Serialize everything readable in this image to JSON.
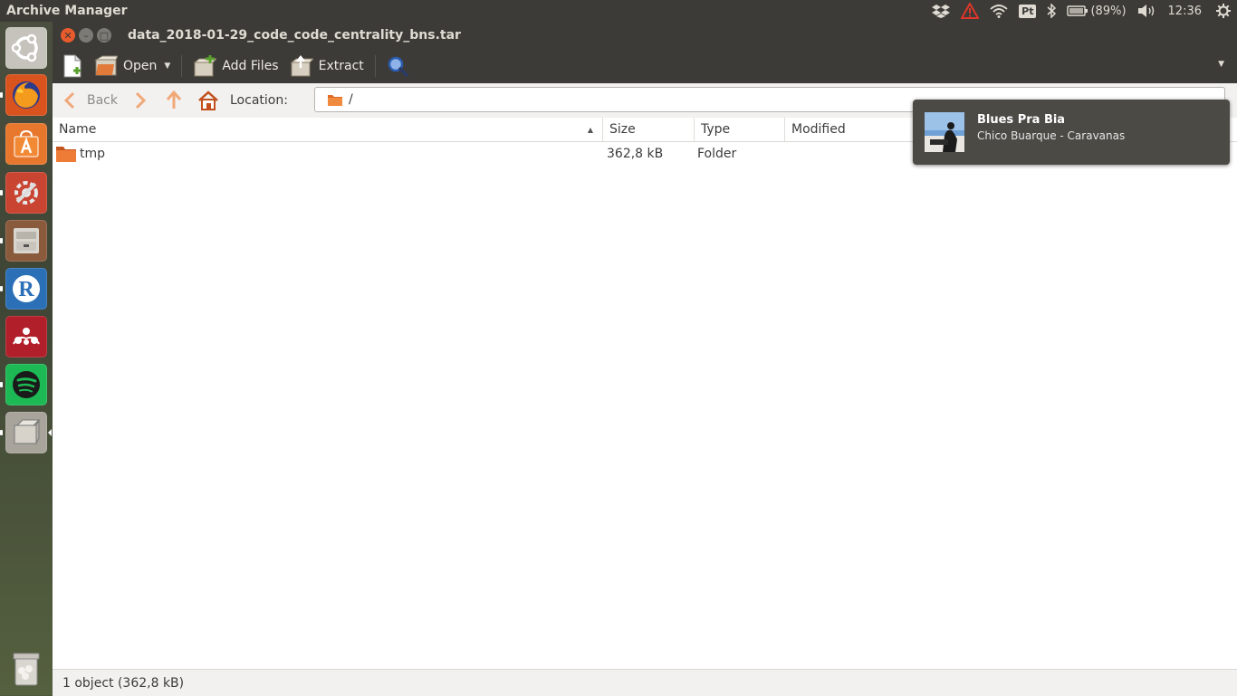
{
  "top_panel": {
    "app_title": "Archive Manager",
    "battery_text": "(89%)",
    "clock": "12:36",
    "indicators": [
      "dropbox-icon",
      "warning-icon",
      "wifi-icon",
      "keyboard-layout-icon",
      "bluetooth-icon",
      "battery-icon",
      "volume-icon",
      "settings-gear-icon"
    ],
    "keyboard_layout": "Pt"
  },
  "launcher": {
    "items": [
      "ubuntu-dash-icon",
      "firefox-icon",
      "software-center-icon",
      "system-settings-icon",
      "file-cabinet-icon",
      "r-language-icon",
      "mendeley-icon",
      "spotify-icon",
      "archive-manager-icon",
      "trash-icon"
    ]
  },
  "window": {
    "title": "data_2018-01-29_code_code_centrality_bns.tar",
    "toolbar": {
      "open_label": "Open",
      "add_files_label": "Add Files",
      "extract_label": "Extract"
    },
    "location": {
      "back_label": "Back",
      "label": "Location:",
      "path": "/"
    },
    "columns": {
      "name": "Name",
      "size": "Size",
      "type": "Type",
      "modified": "Modified"
    },
    "rows": [
      {
        "name": "tmp",
        "size": "362,8 kB",
        "type": "Folder",
        "modified": ""
      }
    ],
    "status": "1 object (362,8 kB)"
  },
  "notification": {
    "title": "Blues Pra Bia",
    "body": "Chico Buarque - Caravanas"
  },
  "colors": {
    "panel": "#3c3b37",
    "accent_orange": "#e85b2c",
    "folder_orange": "#e06a27",
    "notification_bg": "#4b4a45"
  }
}
